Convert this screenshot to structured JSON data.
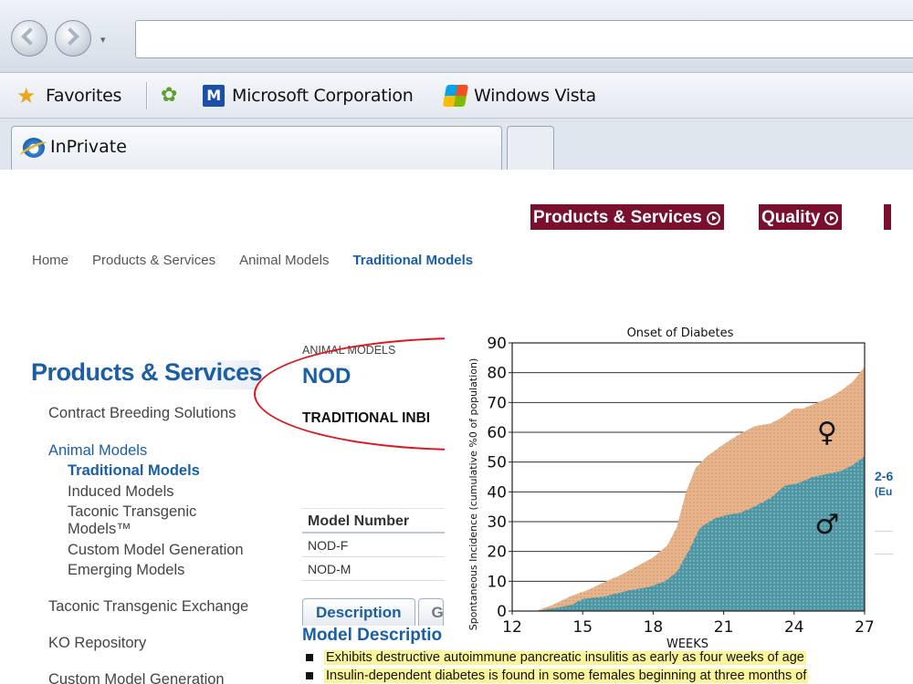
{
  "browser": {
    "favorites_bar": {
      "favorites_label": "Favorites",
      "items": [
        {
          "label": "Microsoft Corporation",
          "icon": "microsoft-icon"
        },
        {
          "label": "Windows Vista",
          "icon": "windows-flag-icon"
        }
      ]
    },
    "tab": {
      "label": "InPrivate",
      "icon": "internet-explorer-icon"
    },
    "address_value": ""
  },
  "site": {
    "top_nav": [
      {
        "label": "Products & Services"
      },
      {
        "label": "Quality"
      }
    ],
    "breadcrumb": [
      "Home",
      "Products & Services",
      "Animal Models",
      "Traditional Models"
    ],
    "sidebar": {
      "title": "Products & Services",
      "items": [
        {
          "label": "Contract Breeding Solutions"
        },
        {
          "label": "Animal Models"
        },
        {
          "label": "Traditional Models"
        },
        {
          "label": "Induced Models"
        },
        {
          "label": "Taconic Transgenic"
        },
        {
          "label": "Models™"
        },
        {
          "label": "Custom Model Generation"
        },
        {
          "label": "Emerging Models"
        },
        {
          "label": "Taconic Transgenic Exchange"
        },
        {
          "label": "KO Repository"
        },
        {
          "label": "Custom Model Generation"
        }
      ]
    },
    "content": {
      "caption": "ANIMAL MODELS",
      "title": "NOD",
      "subtitle": "TRADITIONAL INBI",
      "table": {
        "header": "Model Number",
        "rows": [
          "NOD-F",
          "NOD-M"
        ]
      },
      "tabs": [
        {
          "label": "Description"
        },
        {
          "label": "G"
        }
      ],
      "section_heading": "Model Descriptio",
      "bullets": [
        "Exhibits destructive autoimmune pancreatic insulitis as early as four weeks of age",
        "Insulin-dependent diabetes is found in some females beginning at three months of"
      ],
      "right_edge": {
        "text1": "2-6",
        "text2": "(Eu"
      }
    },
    "colors": {
      "brand_blue": "#1a5fa6",
      "nav_maroon": "#7a0f2e",
      "highlight": "#fbf59a",
      "annotation_red": "#e0141b"
    }
  },
  "chart_data": {
    "type": "area",
    "title": "Onset of Diabetes",
    "xlabel": "WEEKS",
    "ylabel": "Spontaneous Incidence (cumulative %0 of population)",
    "xlim": [
      12,
      27
    ],
    "ylim": [
      0,
      90
    ],
    "xticks": [
      12,
      15,
      18,
      21,
      24,
      27
    ],
    "yticks": [
      0,
      10,
      20,
      30,
      40,
      50,
      60,
      70,
      80,
      90
    ],
    "grid": "horizontal",
    "series": [
      {
        "name": "♀",
        "color": "#e8b48c",
        "x": [
          13.0,
          13.7,
          14.5,
          15.2,
          16.0,
          16.6,
          17.3,
          18.0,
          18.6,
          19.0,
          19.4,
          19.8,
          20.3,
          21.0,
          21.6,
          22.3,
          23.0,
          23.5,
          24.0,
          24.4,
          25.0,
          25.6,
          26.0,
          26.5,
          27.0
        ],
        "values": [
          0,
          2,
          5,
          7,
          10,
          12,
          15,
          18,
          22,
          28,
          40,
          48,
          52,
          56,
          59,
          62,
          63,
          65,
          68,
          68,
          70,
          72,
          74,
          77,
          82
        ]
      },
      {
        "name": "♂",
        "color": "#4f96a4",
        "x": [
          13.0,
          13.8,
          14.5,
          15.0,
          16.0,
          17.0,
          17.8,
          18.5,
          19.0,
          19.5,
          20.0,
          20.6,
          21.0,
          21.7,
          22.3,
          23.0,
          23.6,
          24.2,
          24.8,
          25.4,
          26.0,
          26.5,
          27.0
        ],
        "values": [
          0,
          1,
          2,
          4,
          5,
          7,
          8,
          10,
          13,
          20,
          28,
          31,
          32,
          33,
          35,
          38,
          42,
          43,
          45,
          46,
          47,
          49,
          52
        ]
      }
    ],
    "annotations": [
      {
        "text": "♀",
        "x": 25.4,
        "y": 57
      },
      {
        "text": "♂",
        "x": 25.4,
        "y": 26
      }
    ]
  }
}
